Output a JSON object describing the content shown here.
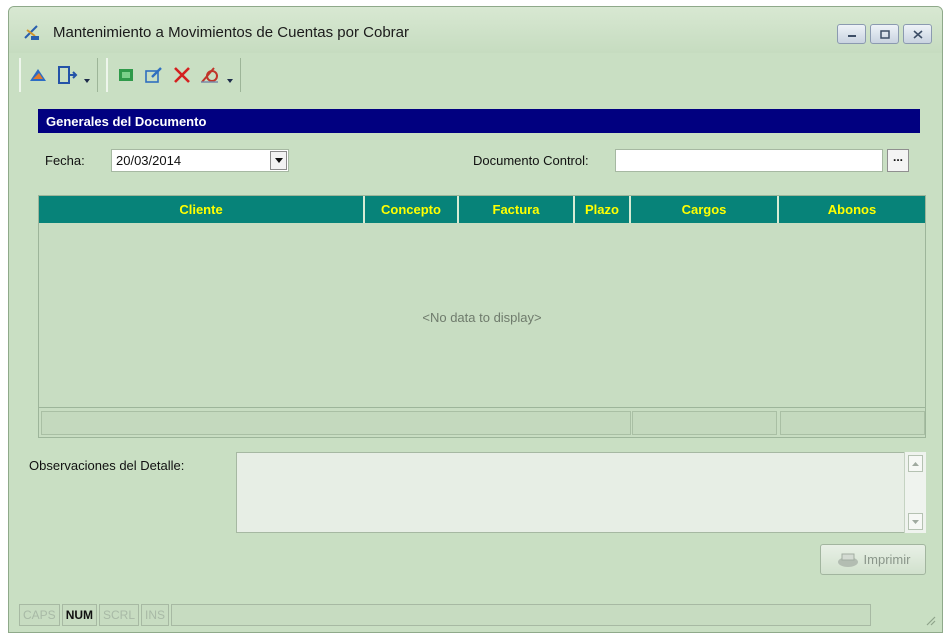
{
  "window": {
    "title": "Mantenimiento a Movimientos de Cuentas por Cobrar",
    "controls": [
      "minimize",
      "restore",
      "close"
    ]
  },
  "toolbar": {
    "group1": [
      {
        "name": "exit-icon",
        "color": "#c8642a"
      },
      {
        "name": "document-arrow-icon",
        "color": "#2453a8"
      }
    ],
    "group2": [
      {
        "name": "new-record-icon",
        "color": "#2f9a4a"
      },
      {
        "name": "edit-icon",
        "color": "#2f6fc0"
      },
      {
        "name": "delete-icon",
        "color": "#d42020"
      },
      {
        "name": "search-icon",
        "color": "#c0352a"
      }
    ]
  },
  "section": {
    "title": "Generales del Documento"
  },
  "form": {
    "fecha_label": "Fecha:",
    "fecha_value": "20/03/2014",
    "documento_label": "Documento Control:",
    "documento_value": "",
    "ellipsis_label": "..."
  },
  "grid": {
    "columns": [
      {
        "label": "Cliente"
      },
      {
        "label": "Concepto"
      },
      {
        "label": "Factura"
      },
      {
        "label": "Plazo"
      },
      {
        "label": "Cargos"
      },
      {
        "label": "Abonos"
      }
    ],
    "empty_message": "<No data to display>"
  },
  "observaciones": {
    "label": "Observaciones del Detalle:",
    "value": ""
  },
  "buttons": {
    "print_label": "Imprimir"
  },
  "statusbar": {
    "panels": [
      {
        "label": "CAPS",
        "active": false
      },
      {
        "label": "NUM",
        "active": true
      },
      {
        "label": "SCRL",
        "active": false
      },
      {
        "label": "INS",
        "active": false
      }
    ]
  },
  "colors": {
    "window_bg": "#c9dfc3",
    "section_header_bg": "#010080",
    "grid_header_bg": "#078379",
    "grid_header_text": "#ffff00"
  }
}
